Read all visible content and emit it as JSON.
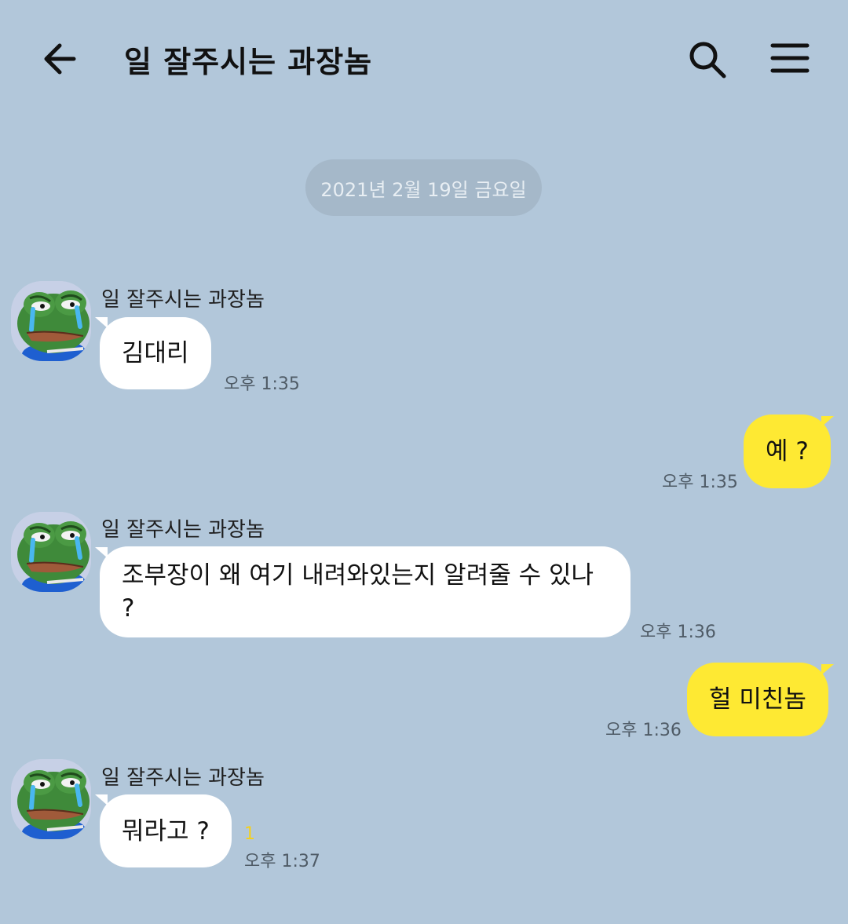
{
  "header": {
    "back_icon": "arrow-left-icon",
    "title": "일 잘주시는 과장놈",
    "search_icon": "search-icon",
    "menu_icon": "hamburger-menu-icon"
  },
  "date_divider": "2021년 2월 19일 금요일",
  "colors": {
    "background": "#b2c7da",
    "incoming_bubble": "#ffffff",
    "outgoing_bubble": "#fee933",
    "unread_count": "#f5d01a"
  },
  "messages": [
    {
      "direction": "incoming",
      "sender": "일 잘주시는 과장놈",
      "text": "김대리",
      "time": "오후 1:35"
    },
    {
      "direction": "outgoing",
      "text": "예 ?",
      "time": "오후 1:35"
    },
    {
      "direction": "incoming",
      "sender": "일 잘주시는 과장놈",
      "text_line1": "조부장이 왜 여기 내려와있는지 알려줄 수 있나",
      "text_line2": "?",
      "time": "오후 1:36"
    },
    {
      "direction": "outgoing",
      "text": "헐 미친놈",
      "time": "오후 1:36"
    },
    {
      "direction": "incoming",
      "sender": "일 잘주시는 과장놈",
      "text": "뭐라고 ?",
      "time": "오후 1:37",
      "unread_count": "1"
    }
  ]
}
